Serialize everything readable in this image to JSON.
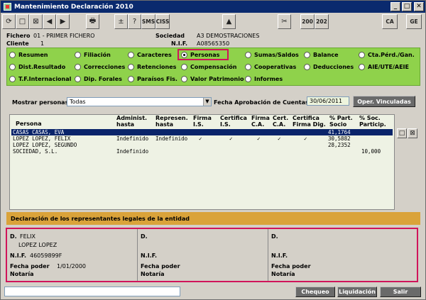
{
  "window": {
    "title": "Mantenimiento Declaración 2010",
    "min": "_",
    "max": "□",
    "close": "✕"
  },
  "toolbar": {
    "refresh": "⟳",
    "new": "□",
    "delete": "⊠",
    "prev": "◀",
    "next": "▶",
    "print": "🖶",
    "plusminus": "±",
    "help": "?",
    "sms": "SMS",
    "ciss": "CISS",
    "alert": "▲",
    "tools": "✂",
    "f200": "200",
    "f202": "202",
    "ca": "CA",
    "ge": "GE"
  },
  "header": {
    "fichero_label": "Fichero",
    "fichero_value": "01 - PRIMER FICHERO",
    "cliente_label": "Cliente",
    "cliente_value": "1",
    "sociedad_label": "Sociedad",
    "sociedad_value": "A3 DEMOSTRACIONES",
    "nif_label": "N.I.F.",
    "nif_value": "A08565350"
  },
  "sections": [
    "Resumen",
    "Filiación",
    "Caracteres",
    "Personas",
    "Sumas/Saldos",
    "Balance",
    "Cta.Pérd./Gan.",
    "Dist.Resultado",
    "Correcciones",
    "Retenciones",
    "Compensación",
    "Cooperativas",
    "Deducciones",
    "AIE/UTE/AEIE",
    "T.F.Internacional",
    "Dip. Forales",
    "Paraísos Fis.",
    "Valor Patrimonio",
    "Informes"
  ],
  "filter": {
    "mostrar_label": "Mostrar personas",
    "mostrar_value": "Todas",
    "fecha_label": "Fecha Aprobación de Cuentas",
    "fecha_value": "30/06/2011",
    "oper_button": "Oper. Vinculadas"
  },
  "table": {
    "headers": {
      "persona": "Persona",
      "admin1": "Administ.",
      "admin2": "hasta",
      "repr1": "Represen.",
      "repr2": "hasta",
      "firma_is1": "Firma",
      "firma_is2": "I.S.",
      "cert_is1": "Certifica",
      "cert_is2": "I.S.",
      "firma_ca1": "Firma",
      "firma_ca2": "C.A.",
      "cert_ca1": "Cert.",
      "cert_ca2": "C.A.",
      "cert_fd1": "Certifica",
      "cert_fd2": "Firma Dig.",
      "part1": "% Part.",
      "part2": "Socio",
      "soc1": "% Soc.",
      "soc2": "Particip."
    },
    "rows": [
      {
        "persona": "CASAS CASAS, EVA",
        "admin": "",
        "repr": "",
        "firma_is": "",
        "cert_is": "",
        "firma_ca": "",
        "cert_ca": "",
        "cert_fd": "",
        "part": "41,1764",
        "soc": ""
      },
      {
        "persona": "LOPEZ LOPEZ, FELIX",
        "admin": "Indefinido",
        "repr": "Indefinido",
        "firma_is": "✓",
        "cert_is": "✓",
        "firma_ca": "✓",
        "cert_ca": "✓",
        "cert_fd": "✓",
        "part": "30,5882",
        "soc": ""
      },
      {
        "persona": "LOPEZ LOPEZ, SEGUNDO",
        "admin": "",
        "repr": "",
        "firma_is": "",
        "cert_is": "",
        "firma_ca": "",
        "cert_ca": "",
        "cert_fd": "",
        "part": "28,2352",
        "soc": ""
      },
      {
        "persona": "SOCIEDAD, S.L.",
        "admin": "Indefinido",
        "repr": "",
        "firma_is": "",
        "cert_is": "",
        "firma_ca": "",
        "cert_ca": "",
        "cert_fd": "",
        "part": "",
        "soc": "10,000"
      }
    ],
    "side_new": "□",
    "side_delete": "⊠"
  },
  "declaracion_title": "Declaración de los representantes legales de la entidad",
  "reps": [
    {
      "d_label": "D.",
      "name": "FELIX",
      "surname": "LOPEZ LOPEZ",
      "nif_label": "N.I.F.",
      "nif_value": "46059899F",
      "fecha_label": "Fecha poder",
      "fecha_value": "1/01/2000",
      "notaria_label": "Notaría"
    },
    {
      "d_label": "D.",
      "name": "",
      "surname": "",
      "nif_label": "N.I.F.",
      "nif_value": "",
      "fecha_label": "Fecha poder",
      "fecha_value": "",
      "notaria_label": "Notaría"
    },
    {
      "d_label": "D.",
      "name": "",
      "surname": "",
      "nif_label": "N.I.F.",
      "nif_value": "",
      "fecha_label": "Fecha poder",
      "fecha_value": "",
      "notaria_label": "Notaría"
    }
  ],
  "footer": {
    "chequeo": "Chequeo",
    "liquidacion": "Liquidación",
    "salir": "Salir"
  }
}
